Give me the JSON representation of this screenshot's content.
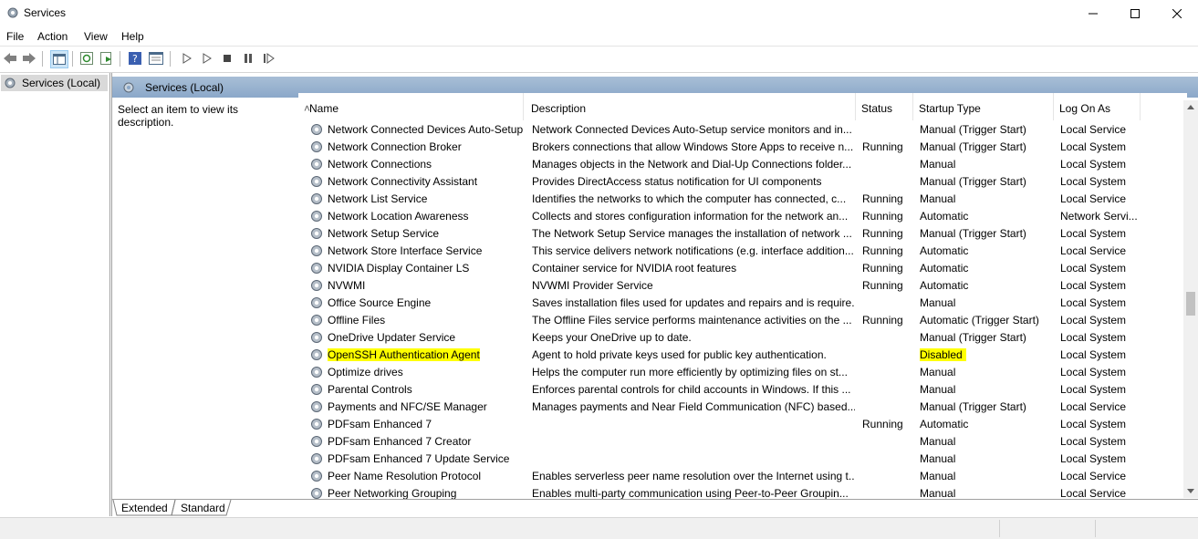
{
  "window": {
    "title": "Services"
  },
  "menu": [
    "File",
    "Action",
    "View",
    "Help"
  ],
  "tree": {
    "root_label": "Services (Local)"
  },
  "panel": {
    "header_label": "Services (Local)",
    "description_prompt": "Select an item to view its description."
  },
  "columns": {
    "name": "Name",
    "description": "Description",
    "status": "Status",
    "startup": "Startup Type",
    "logon": "Log On As"
  },
  "highlight_color": "#ffff00",
  "services": [
    {
      "name": "Network Connected Devices Auto-Setup",
      "description": "Network Connected Devices Auto-Setup service monitors and in...",
      "status": "",
      "startup": "Manual (Trigger Start)",
      "logon": "Local Service"
    },
    {
      "name": "Network Connection Broker",
      "description": "Brokers connections that allow Windows Store Apps to receive n...",
      "status": "Running",
      "startup": "Manual (Trigger Start)",
      "logon": "Local System"
    },
    {
      "name": "Network Connections",
      "description": "Manages objects in the Network and Dial-Up Connections folder...",
      "status": "",
      "startup": "Manual",
      "logon": "Local System"
    },
    {
      "name": "Network Connectivity Assistant",
      "description": "Provides DirectAccess status notification for UI components",
      "status": "",
      "startup": "Manual (Trigger Start)",
      "logon": "Local System"
    },
    {
      "name": "Network List Service",
      "description": "Identifies the networks to which the computer has connected, c...",
      "status": "Running",
      "startup": "Manual",
      "logon": "Local Service"
    },
    {
      "name": "Network Location Awareness",
      "description": "Collects and stores configuration information for the network an...",
      "status": "Running",
      "startup": "Automatic",
      "logon": "Network Servi..."
    },
    {
      "name": "Network Setup Service",
      "description": "The Network Setup Service manages the installation of network ...",
      "status": "Running",
      "startup": "Manual (Trigger Start)",
      "logon": "Local System"
    },
    {
      "name": "Network Store Interface Service",
      "description": "This service delivers network notifications (e.g. interface addition...",
      "status": "Running",
      "startup": "Automatic",
      "logon": "Local Service"
    },
    {
      "name": "NVIDIA Display Container LS",
      "description": "Container service for NVIDIA root features",
      "status": "Running",
      "startup": "Automatic",
      "logon": "Local System"
    },
    {
      "name": "NVWMI",
      "description": "NVWMI Provider Service",
      "status": "Running",
      "startup": "Automatic",
      "logon": "Local System"
    },
    {
      "name": "Office  Source Engine",
      "description": "Saves installation files used for updates and repairs and is require...",
      "status": "",
      "startup": "Manual",
      "logon": "Local System"
    },
    {
      "name": "Offline Files",
      "description": "The Offline Files service performs maintenance activities on the ...",
      "status": "Running",
      "startup": "Automatic (Trigger Start)",
      "logon": "Local System"
    },
    {
      "name": "OneDrive Updater Service",
      "description": "Keeps your OneDrive up to date.",
      "status": "",
      "startup": "Manual (Trigger Start)",
      "logon": "Local System"
    },
    {
      "name": "OpenSSH Authentication Agent",
      "description": "Agent to hold private keys used for public key authentication.",
      "status": "",
      "startup": "Disabled",
      "logon": "Local System",
      "highlighted": true
    },
    {
      "name": "Optimize drives",
      "description": "Helps the computer run more efficiently by optimizing files on st...",
      "status": "",
      "startup": "Manual",
      "logon": "Local System"
    },
    {
      "name": "Parental Controls",
      "description": "Enforces parental controls for child accounts in Windows. If this ...",
      "status": "",
      "startup": "Manual",
      "logon": "Local System"
    },
    {
      "name": "Payments and NFC/SE Manager",
      "description": "Manages payments and Near Field Communication (NFC) based...",
      "status": "",
      "startup": "Manual (Trigger Start)",
      "logon": "Local Service"
    },
    {
      "name": "PDFsam Enhanced 7",
      "description": "",
      "status": "Running",
      "startup": "Automatic",
      "logon": "Local System"
    },
    {
      "name": "PDFsam Enhanced 7 Creator",
      "description": "",
      "status": "",
      "startup": "Manual",
      "logon": "Local System"
    },
    {
      "name": "PDFsam Enhanced 7 Update Service",
      "description": "",
      "status": "",
      "startup": "Manual",
      "logon": "Local System"
    },
    {
      "name": "Peer Name Resolution Protocol",
      "description": "Enables serverless peer name resolution over the Internet using t...",
      "status": "",
      "startup": "Manual",
      "logon": "Local Service"
    },
    {
      "name": "Peer Networking Grouping",
      "description": "Enables multi-party communication using Peer-to-Peer Groupin...",
      "status": "",
      "startup": "Manual",
      "logon": "Local Service"
    }
  ],
  "tabs": [
    "Extended",
    "Standard"
  ]
}
